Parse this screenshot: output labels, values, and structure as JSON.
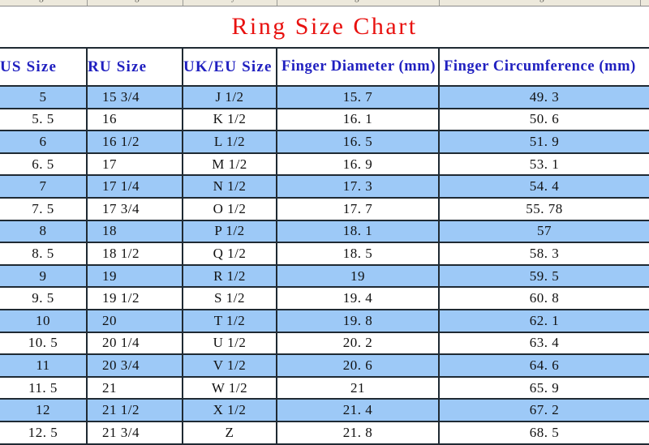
{
  "top_strip": {
    "background_color": "#EDE9DC",
    "note": "cut-off row from preceding table"
  },
  "title": {
    "text": "Ring Size Chart",
    "color": "#E8110F"
  },
  "table": {
    "header_color": "#2020C0",
    "row_highlight_color": "#9DC9F7",
    "border_color": "#1F2A33",
    "columns": [
      "US Size",
      "RU Size",
      "UK/EU Size",
      "Finger Diameter (mm)",
      "Finger Circumference (mm)"
    ],
    "rows": [
      [
        "5",
        "15 3/4",
        "J 1/2",
        "15.7",
        "49.3"
      ],
      [
        "5.5",
        "16",
        "K 1/2",
        "16.1",
        "50.6"
      ],
      [
        "6",
        "16 1/2",
        "L 1/2",
        "16.5",
        "51.9"
      ],
      [
        "6.5",
        "17",
        "M 1/2",
        "16.9",
        "53.1"
      ],
      [
        "7",
        "17 1/4",
        "N 1/2",
        "17.3",
        "54.4"
      ],
      [
        "7.5",
        "17 3/4",
        "O 1/2",
        "17.7",
        "55.78"
      ],
      [
        "8",
        "18",
        "P 1/2",
        "18.1",
        "57"
      ],
      [
        "8.5",
        "18 1/2",
        "Q 1/2",
        "18.5",
        "58.3"
      ],
      [
        "9",
        "19",
        "R 1/2",
        "19",
        "59.5"
      ],
      [
        "9.5",
        "19 1/2",
        "S 1/2",
        "19.4",
        "60.8"
      ],
      [
        "10",
        "20",
        "T 1/2",
        "19.8",
        "62.1"
      ],
      [
        "10.5",
        "20 1/4",
        "U 1/2",
        "20.2",
        "63.4"
      ],
      [
        "11",
        "20 3/4",
        "V 1/2",
        "20.6",
        "64.6"
      ],
      [
        "11.5",
        "21",
        "W 1/2",
        "21",
        "65.9"
      ],
      [
        "12",
        "21 1/2",
        "X 1/2",
        "21.4",
        "67.2"
      ],
      [
        "12.5",
        "21 3/4",
        "Z",
        "21.8",
        "68.5"
      ]
    ]
  }
}
